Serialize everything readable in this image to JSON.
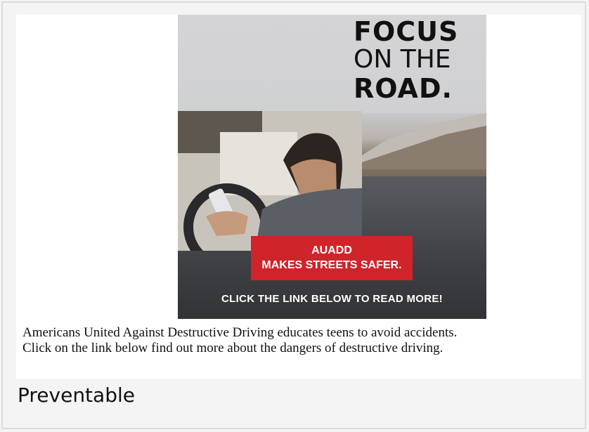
{
  "ad": {
    "headline_line1": "FOCUS",
    "headline_line2": "ON THE",
    "headline_line3": "ROAD.",
    "badge_line1": "AUADD",
    "badge_line2": "MAKES STREETS SAFER.",
    "cta": "CLICK THE LINK BELOW TO READ MORE!",
    "accent_color": "#d1232a"
  },
  "caption": "Americans United Against Destructive Driving educates teens to avoid accidents. Click on the link below find out more about the dangers of destructive driving.",
  "subtitle": "Preventable"
}
